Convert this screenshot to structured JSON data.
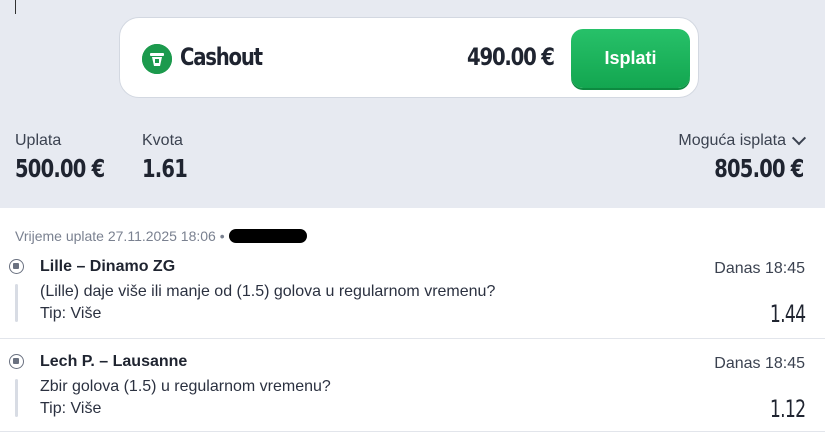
{
  "cashout": {
    "title": "Cashout",
    "amount": "490.00 €",
    "button_label": "Isplati"
  },
  "summary": {
    "stake_label": "Uplata",
    "stake_value": "500.00 €",
    "odds_label": "Kvota",
    "odds_value": "1.61",
    "payout_label": "Moguća isplata",
    "payout_value": "805.00 €"
  },
  "ticket": {
    "time_text": "Vrijeme uplate 27.11.2025 18:06 •"
  },
  "matches": [
    {
      "title": "Lille – Dinamo ZG",
      "time": "Danas 18:45",
      "market": "(Lille) daje više ili manje od (1.5) golova u regularnom vremenu?",
      "tip": "Tip: Više",
      "odds": "1.44"
    },
    {
      "title": "Lech P. – Lausanne",
      "time": "Danas 18:45",
      "market": "Zbir golova (1.5) u regularnom vremenu?",
      "tip": "Tip: Više",
      "odds": "1.12"
    }
  ],
  "colors": {
    "accent_green": "#1ab35b",
    "header_bg": "#e7eaf1"
  },
  "icons": [
    "cashout-icon",
    "chevron-down-icon",
    "soccer-ball-icon"
  ]
}
